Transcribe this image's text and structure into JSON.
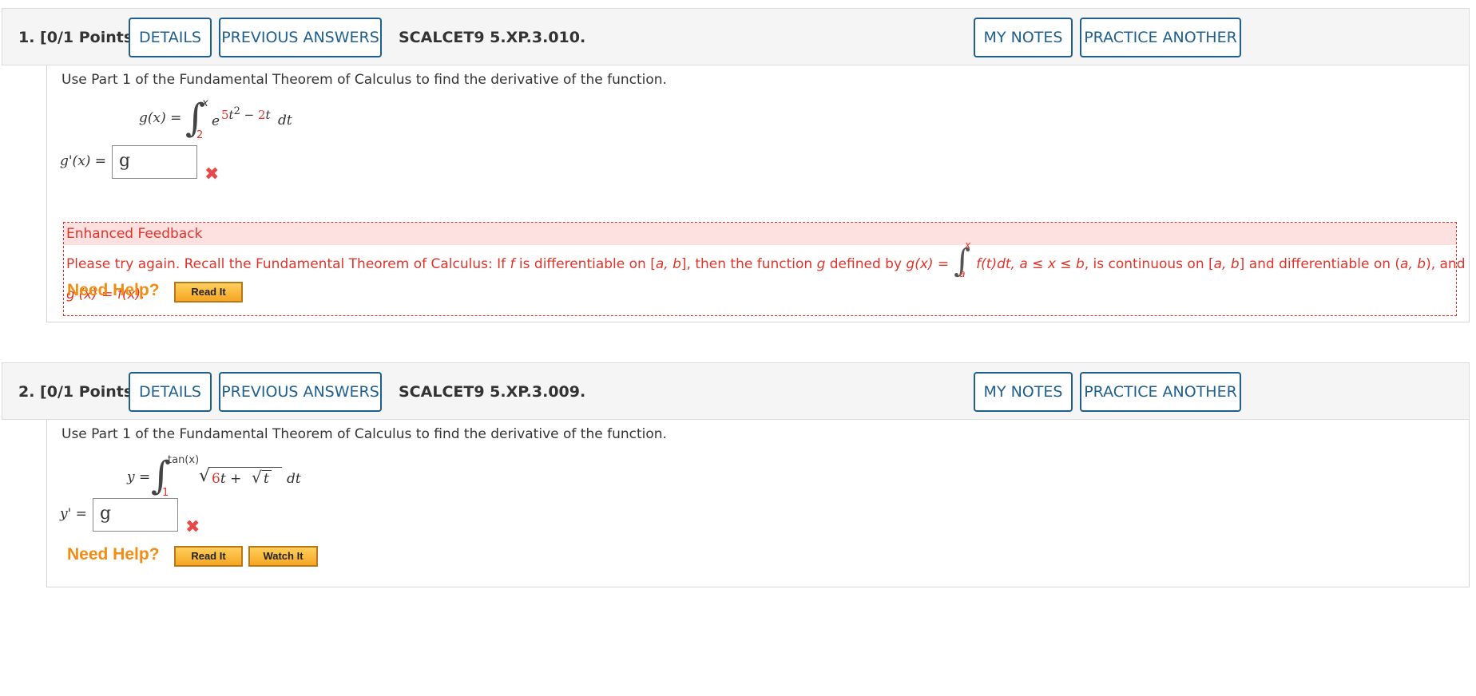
{
  "questions": [
    {
      "title": "1.  [0/1 Points]",
      "details_label": "DETAILS",
      "previous_answers_label": "PREVIOUS ANSWERS",
      "code": "SCALCET9 5.XP.3.010.",
      "my_notes_label": "MY NOTES",
      "practice_label": "PRACTICE ANOTHER",
      "instruction": "Use Part 1 of the Fundamental Theorem of Calculus to find the derivative of the function.",
      "formula": {
        "lhs": "g(x) =",
        "upper": "x",
        "lower": "2",
        "base": "e",
        "exp_coef1": "5",
        "exp_var": "t",
        "exp_pow": "2",
        "exp_mid": " − ",
        "exp_coef2": "2",
        "exp_var2": "t",
        "dt": "dt"
      },
      "answer_label": "g'(x) =",
      "answer_value": "g",
      "feedback": {
        "heading": "Enhanced Feedback",
        "line1_a": "Please try again. Recall the Fundamental Theorem of Calculus: If ",
        "line1_f": "f",
        "line1_b": " is differentiable on [",
        "line1_interval1": "a, b",
        "line1_c": "], then the function ",
        "line1_g": "g",
        "line1_d": " defined by ",
        "line1_gx": "g(x) =",
        "int_upper": "x",
        "int_lower": "a",
        "line1_e": "f(t)dt, ",
        "line1_ineq": "a ≤ x ≤ b",
        "line1_f2": ", is continuous on [",
        "line1_interval2": "a, b",
        "line1_g2": "] and differentiable on (",
        "line1_interval3": "a, b",
        "line1_h": "), and",
        "line2": "g'(x) = f(x)."
      },
      "need_help_label": "Need Help?",
      "read_it_label": "Read It"
    },
    {
      "title": "2.  [0/1 Points]",
      "details_label": "DETAILS",
      "previous_answers_label": "PREVIOUS ANSWERS",
      "code": "SCALCET9 5.XP.3.009.",
      "my_notes_label": "MY NOTES",
      "practice_label": "PRACTICE ANOTHER",
      "instruction": "Use Part 1 of the Fundamental Theorem of Calculus to find the derivative of the function.",
      "formula": {
        "lhs": "y =",
        "upper": "tan(x)",
        "lower": "1",
        "coef": "6",
        "var": "t",
        "plus": " + ",
        "inner_var": "t",
        "dt": "dt"
      },
      "answer_label": "y' =",
      "answer_value": "g",
      "need_help_label": "Need Help?",
      "read_it_label": "Read It",
      "watch_it_label": "Watch It"
    }
  ]
}
